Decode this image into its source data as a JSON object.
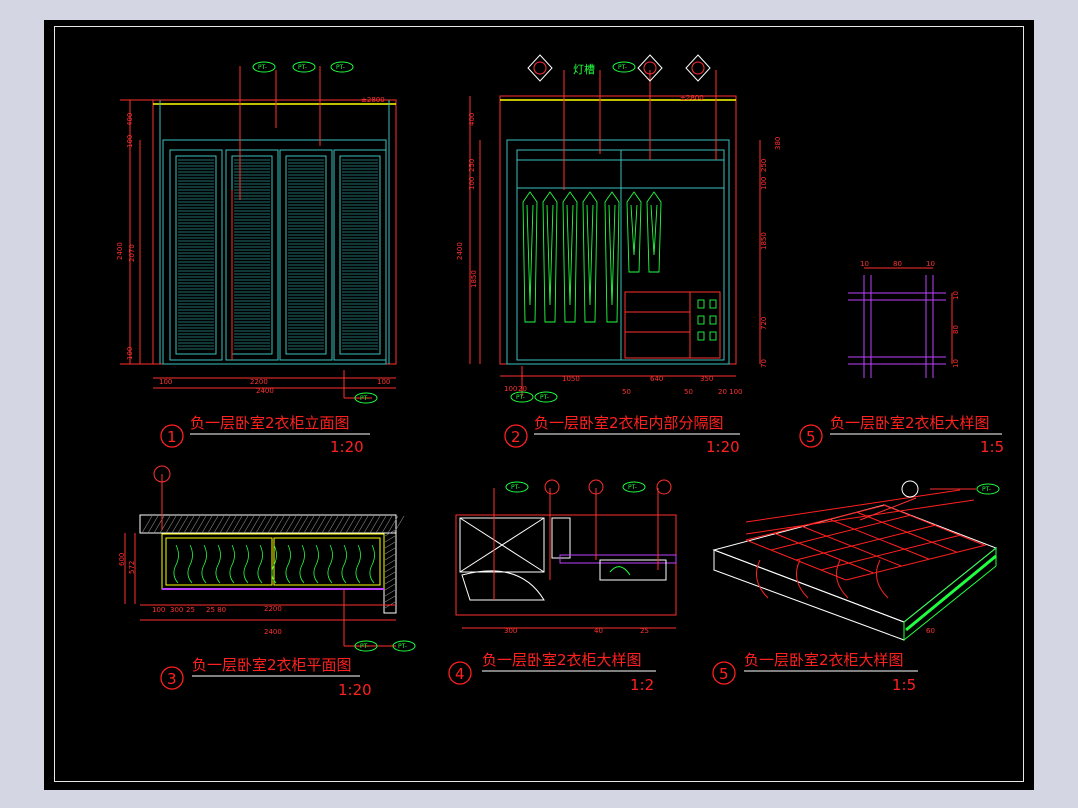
{
  "drawings": [
    {
      "number": "1",
      "title": "负一层卧室2衣柜立面图",
      "scale": "1:20"
    },
    {
      "number": "2",
      "title": "负一层卧室2衣柜内部分隔图",
      "scale": "1:20"
    },
    {
      "number": "5",
      "title": "负一层卧室2衣柜大样图",
      "scale": "1:5"
    },
    {
      "number": "3",
      "title": "负一层卧室2衣柜平面图",
      "scale": "1:20"
    },
    {
      "number": "4",
      "title": "负一层卧室2衣柜大样图",
      "scale": "1:2"
    },
    {
      "number": "5",
      "title": "负一层卧室2衣柜大样图",
      "scale": "1:5"
    }
  ],
  "annotations": {
    "light_slot": "灯槽",
    "tag": "PT-",
    "level_mark": "±2800"
  },
  "dims": {
    "d1_bottom_total": "2400",
    "d1_bottom_inner": "2200",
    "d1_left_side": "100",
    "d1_right_side": "100",
    "d1_height_total": "2400",
    "d1_height_inner": "2070",
    "d1_top": "400",
    "d1_top2": "100",
    "d1_base": "100",
    "d2_bottom_1": "1050",
    "d2_bottom_2": "640",
    "d2_bottom_3": "350",
    "d2_bottom_left": "100",
    "d2_bottom_20": "20",
    "d2_bottom_50a": "50",
    "d2_bottom_50b": "50",
    "d2_bottom_right": "20 100",
    "d2_left_total": "2400",
    "d2_left_1850": "1850",
    "d2_left_top": "400",
    "d2_left_250": "250",
    "d2_left_100": "100",
    "d2_right_1850": "1850",
    "d2_right_720": "720",
    "d2_right_250": "250",
    "d2_right_100": "100",
    "d2_right_70": "70",
    "d2_right_380": "380",
    "d5a_top_10a": "10",
    "d5a_top_80": "80",
    "d5a_top_10b": "10",
    "d5a_right_10a": "10",
    "d5a_right_80": "80",
    "d5a_right_10b": "10",
    "d3_total": "2400",
    "d3_inner": "2200",
    "d3_left_600": "600",
    "d3_left_572": "572",
    "d3_bottom_100": "100",
    "d3_bottom_300": "300",
    "d3_bottom_25a": "25",
    "d3_bottom_25b": "25 80",
    "d4_b_300": "300",
    "d4_b_40": "40",
    "d4_b_25": "25",
    "d5b_60": "60"
  }
}
